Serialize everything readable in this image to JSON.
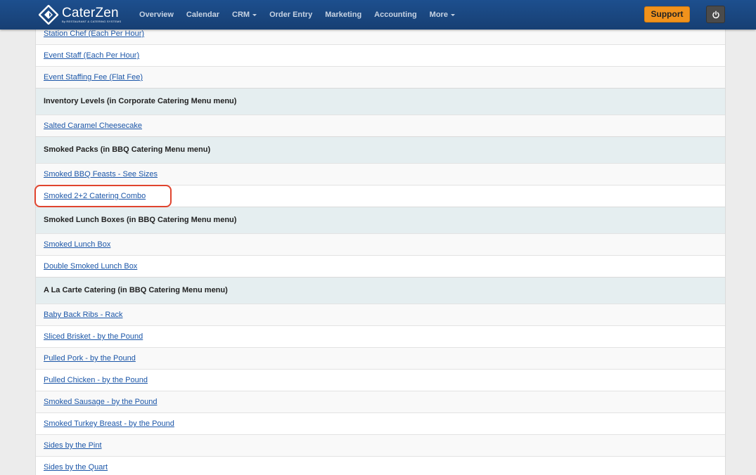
{
  "brand": {
    "name": "CaterZen",
    "sub": "By RESTAURANT & CATERING SYSTEMS"
  },
  "nav": {
    "items": [
      {
        "label": "Overview",
        "dropdown": false
      },
      {
        "label": "Calendar",
        "dropdown": false
      },
      {
        "label": "CRM",
        "dropdown": true
      },
      {
        "label": "Order Entry",
        "dropdown": false
      },
      {
        "label": "Marketing",
        "dropdown": false
      },
      {
        "label": "Accounting",
        "dropdown": false
      },
      {
        "label": "More",
        "dropdown": true
      }
    ],
    "support_label": "Support"
  },
  "list": [
    {
      "kind": "item",
      "label": "Station Chef (Each Per Hour)"
    },
    {
      "kind": "item",
      "label": "Event Staff (Each Per Hour)"
    },
    {
      "kind": "item",
      "label": "Event Staffing Fee (Flat Fee)"
    },
    {
      "kind": "header",
      "label": "Inventory Levels (in Corporate Catering Menu menu)"
    },
    {
      "kind": "item",
      "label": "Salted Caramel Cheesecake"
    },
    {
      "kind": "header",
      "label": "Smoked Packs (in BBQ Catering Menu menu)"
    },
    {
      "kind": "item",
      "label": "Smoked BBQ Feasts - See Sizes"
    },
    {
      "kind": "item",
      "label": "Smoked 2+2 Catering Combo",
      "highlighted": true
    },
    {
      "kind": "header",
      "label": "Smoked Lunch Boxes (in BBQ Catering Menu menu)"
    },
    {
      "kind": "item",
      "label": "Smoked Lunch Box"
    },
    {
      "kind": "item",
      "label": "Double Smoked Lunch Box"
    },
    {
      "kind": "header",
      "label": "A La Carte Catering (in BBQ Catering Menu menu)"
    },
    {
      "kind": "item",
      "label": "Baby Back Ribs - Rack"
    },
    {
      "kind": "item",
      "label": "Sliced Brisket - by the Pound"
    },
    {
      "kind": "item",
      "label": "Pulled Pork - by the Pound"
    },
    {
      "kind": "item",
      "label": "Pulled Chicken - by the Pound"
    },
    {
      "kind": "item",
      "label": "Smoked Sausage - by the Pound"
    },
    {
      "kind": "item",
      "label": "Smoked Turkey Breast - by the Pound"
    },
    {
      "kind": "item",
      "label": "Sides by the Pint"
    },
    {
      "kind": "item",
      "label": "Sides by the Quart"
    }
  ],
  "colors": {
    "navbar": "#1d4f8e",
    "support": "#f0921c",
    "header_row": "#e5eef0",
    "link": "#1b56a8",
    "highlight": "#e0442e"
  }
}
